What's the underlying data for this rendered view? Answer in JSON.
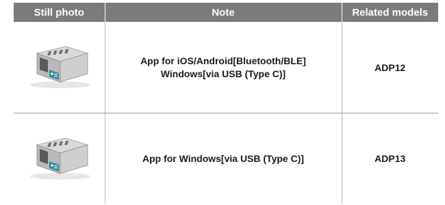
{
  "table": {
    "headers": [
      "Still photo",
      "Note",
      "Related models"
    ],
    "rows": [
      {
        "photo_icon": "adapter-device-photo",
        "note_lines": [
          "App for iOS/Android[Bluetooth/BLE]",
          "Windows[via USB (Type C)]"
        ],
        "model": "ADP12"
      },
      {
        "photo_icon": "adapter-device-photo",
        "note_lines": [
          "App for Windows[via USB (Type C)]"
        ],
        "model": "ADP13"
      }
    ]
  },
  "colors": {
    "header_bg": "#7b7b7b",
    "header_text": "#ffffff",
    "device_body": "#c9c9c9",
    "device_accent": "#2f8f96"
  }
}
